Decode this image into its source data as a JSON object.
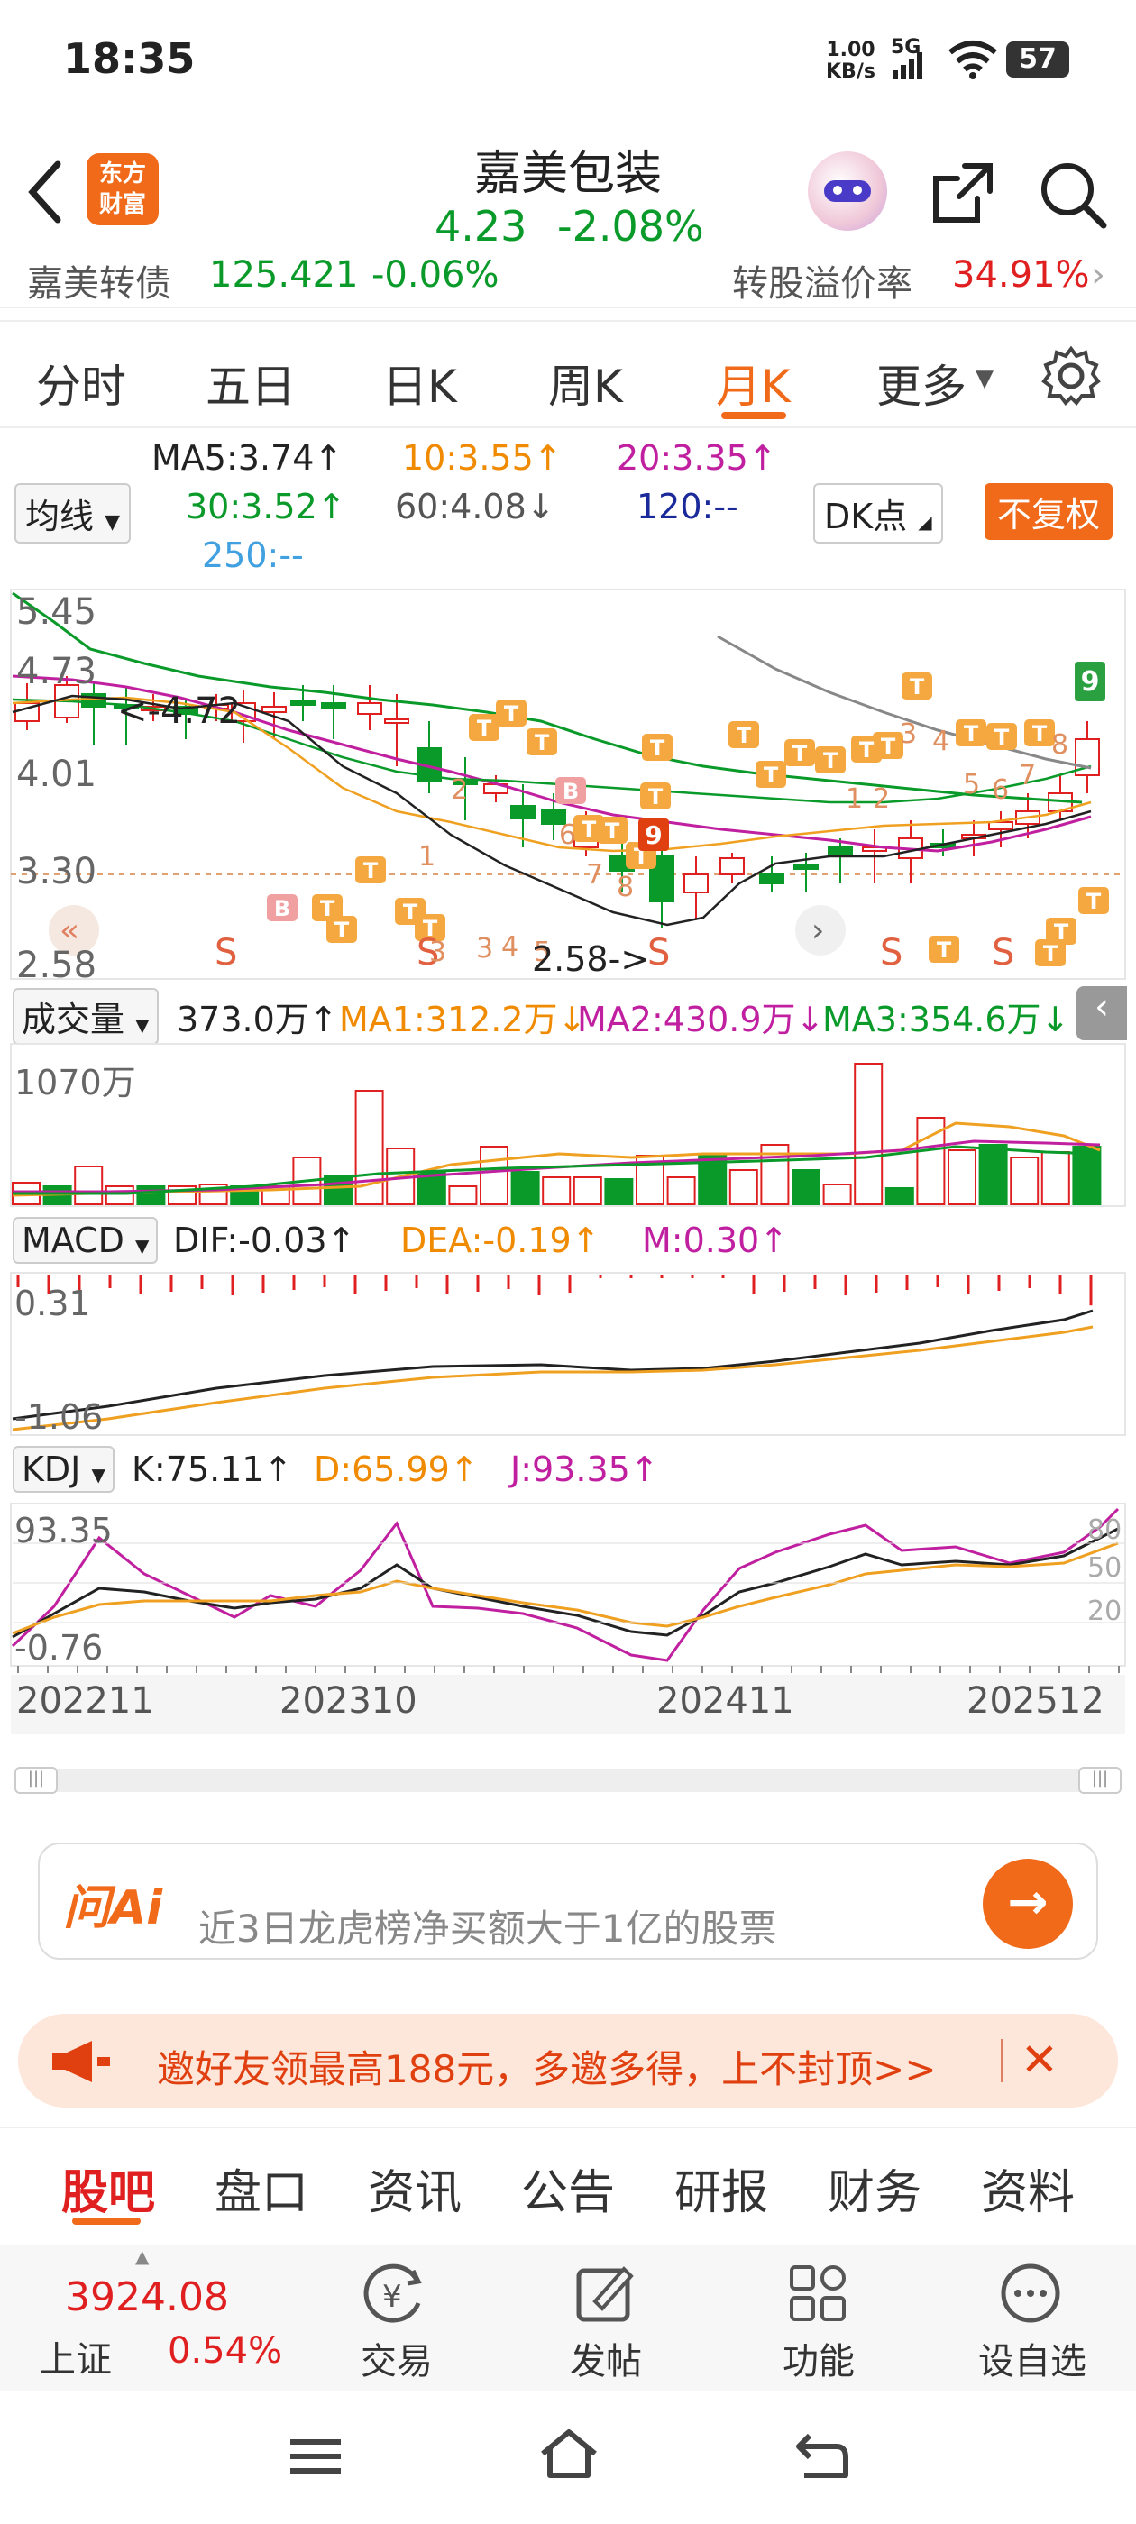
{
  "status_bar": {
    "time": "18:35",
    "net_speed": "1.00",
    "net_unit": "KB/s",
    "signal": "5G",
    "battery": "57"
  },
  "header": {
    "stock_name": "嘉美包装",
    "price": "4.23",
    "change_pct": "-2.08%",
    "logo_line1": "东方",
    "logo_line2": "财富"
  },
  "bond_bar": {
    "name": "嘉美转债",
    "price": "125.421",
    "change": "-0.06%",
    "premium_label": "转股溢价率",
    "premium_value": "34.91%"
  },
  "tabs": [
    "分时",
    "五日",
    "日K",
    "周K",
    "月K",
    "更多"
  ],
  "active_tab": "月K",
  "ma": {
    "selector": "均线",
    "ma5": "MA5:3.74↑",
    "ma10": "10:3.55↑",
    "ma20": "20:3.35↑",
    "ma30": "30:3.52↑",
    "ma60": "60:4.08↓",
    "ma120": "120:--",
    "ma250": "250:--",
    "dk_button": "DK点",
    "fq_button": "不复权"
  },
  "price_axis": [
    "5.45",
    "4.73",
    "4.01",
    "3.30",
    "2.58"
  ],
  "annotations": {
    "high": "<-4.72",
    "low": "2.58->",
    "signal_9": "9"
  },
  "volume": {
    "selector": "成交量",
    "value": "373.0万↑",
    "ma1": "MA1:312.2万↓",
    "ma2": "MA2:430.9万↓",
    "ma3": "MA3:354.6万↓",
    "axis": "1070万"
  },
  "macd": {
    "selector": "MACD",
    "dif": "DIF:-0.03↑",
    "dea": "DEA:-0.19↑",
    "m": "M:0.30↑",
    "axis_top": "0.31",
    "axis_bottom": "-1.06"
  },
  "kdj": {
    "selector": "KDJ",
    "k": "K:75.11↑",
    "d": "D:65.99↑",
    "j": "J:93.35↑",
    "axis_top": "93.35",
    "axis_bottom": "-0.76",
    "levels": [
      "80",
      "50",
      "20"
    ]
  },
  "x_axis": [
    "202211",
    "202310",
    "202411",
    "202512"
  ],
  "ai": {
    "brand": "问Ai",
    "placeholder": "近3日龙虎榜净买额大于1亿的股票"
  },
  "promo": {
    "text": "邀好友领最高188元，多邀多得，上不封顶>>"
  },
  "bottom_tabs": [
    "股吧",
    "盘口",
    "资讯",
    "公告",
    "研报",
    "财务",
    "资料"
  ],
  "active_bottom_tab": "股吧",
  "dock": {
    "index_value": "3924.08",
    "index_name": "上证",
    "index_change": "0.54%",
    "trade": "交易",
    "post": "发帖",
    "func": "功能",
    "watch": "设自选"
  },
  "colors": {
    "up": "#e02020",
    "down": "#0a9a2a",
    "accent": "#f06a1a",
    "active": "#f06a1a"
  }
}
